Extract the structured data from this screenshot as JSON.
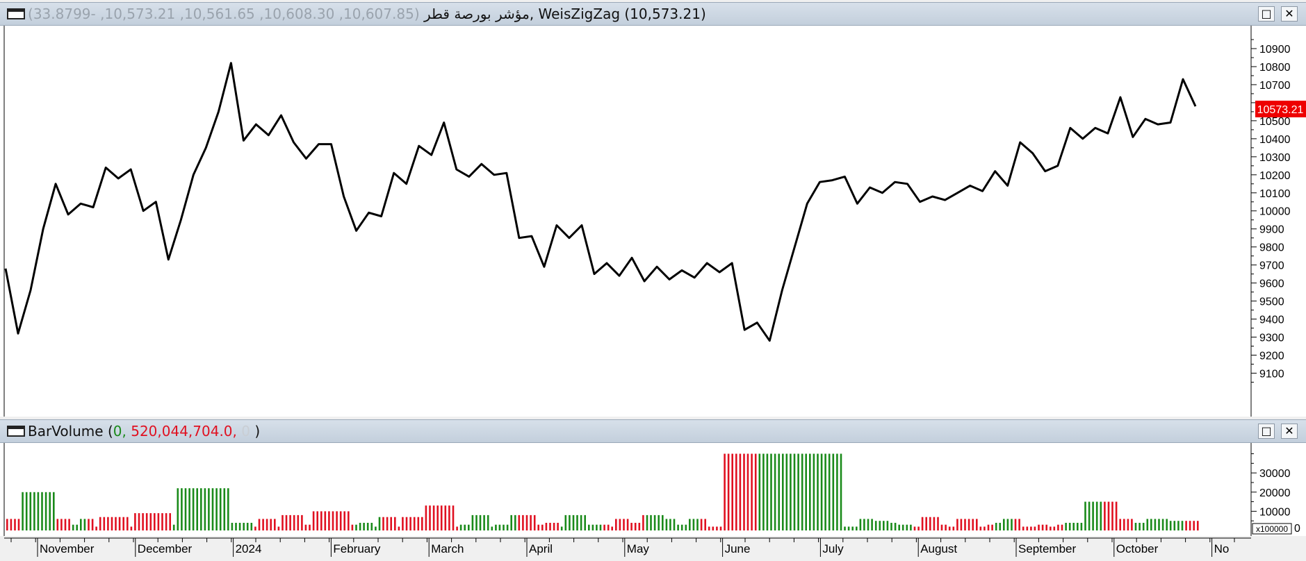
{
  "price_pane": {
    "title_name": "مؤشر بورصة قطر",
    "title_ohlc": "(10,607.85, 10,608.30, 10,561.65, 10,573.21, -33.8799)",
    "title_indicator": ", WeisZigZag (10,573.21)",
    "last_value_label": "10573.21",
    "maximize_icon": "maximize-icon",
    "close_icon": "close-icon"
  },
  "volume_pane": {
    "title_name": "BarVolume",
    "title_open": " (",
    "title_v1": "0,",
    "title_v2": " 520,044,704.0,",
    "title_v3": " 0",
    "title_close": " )",
    "multiplier_label": "x100000",
    "maximize_icon": "maximize-icon",
    "close_icon": "close-icon"
  },
  "chart_data": [
    {
      "type": "line",
      "series": [
        {
          "values": [
            9680,
            9320,
            9560,
            9900,
            10150,
            9980,
            10040,
            10020,
            10240,
            10180,
            10230,
            10000,
            10050,
            9730,
            9950,
            10200,
            10350,
            10550,
            10820,
            10390,
            10480,
            10420,
            10530,
            10380,
            10290,
            10370,
            10370,
            10080,
            9890,
            9990,
            9970,
            10210,
            10150,
            10360,
            10310,
            10490,
            10230,
            10190,
            10260,
            10200,
            10210,
            9850,
            9860,
            9690,
            9920,
            9850,
            9920,
            9650,
            9710,
            9640,
            9740,
            9610,
            9690,
            9620,
            9670,
            9630,
            9710,
            9660,
            9710,
            9340,
            9380,
            9280,
            9560,
            9800,
            10040,
            10160,
            10170,
            10190,
            10040,
            10130,
            10100,
            10160,
            10150,
            10050,
            10080,
            10060,
            10100,
            10140,
            10110,
            10220,
            10140,
            10380,
            10320,
            10220,
            10250,
            10460,
            10400,
            10460,
            10430,
            10630,
            10410,
            10510,
            10480,
            10490,
            10730,
            10580
          ]
        }
      ],
      "ylim": [
        9000,
        11000
      ],
      "yticks": [
        9100,
        9200,
        9300,
        9400,
        9500,
        9600,
        9700,
        9800,
        9900,
        10000,
        10100,
        10200,
        10300,
        10400,
        10500,
        10600,
        10700,
        10800,
        10900
      ],
      "ytick_labels": [
        "9100",
        "9200",
        "9300",
        "9400",
        "9500",
        "9600",
        "9700",
        "9800",
        "9900",
        "10000",
        "10100",
        "10200",
        "10300",
        "10400",
        "10500",
        "",
        "10700",
        "10800",
        "10900"
      ]
    },
    {
      "type": "bar",
      "values": [
        6,
        6,
        6,
        6,
        20,
        20,
        20,
        20,
        20,
        20,
        20,
        20,
        20,
        6,
        6,
        6,
        6,
        3,
        3,
        6,
        6,
        6,
        6,
        2,
        7,
        7,
        7,
        7,
        7,
        7,
        7,
        7,
        2,
        9,
        9,
        9,
        9,
        9,
        9,
        9,
        9,
        9,
        9,
        3,
        22,
        22,
        22,
        22,
        22,
        22,
        22,
        22,
        22,
        22,
        22,
        22,
        22,
        22,
        4,
        4,
        4,
        4,
        4,
        4,
        2,
        6,
        6,
        6,
        6,
        6,
        2,
        8,
        8,
        8,
        8,
        8,
        8,
        3,
        3,
        10,
        10,
        10,
        10,
        10,
        10,
        10,
        10,
        10,
        10,
        3,
        3,
        4,
        4,
        4,
        4,
        2,
        7,
        7,
        7,
        7,
        7,
        2,
        7,
        7,
        7,
        7,
        7,
        7,
        13,
        13,
        13,
        13,
        13,
        13,
        13,
        13,
        2,
        3,
        3,
        3,
        8,
        8,
        8,
        8,
        8,
        2,
        3,
        3,
        3,
        3,
        8,
        8,
        8,
        8,
        8,
        8,
        8,
        3,
        3,
        4,
        4,
        4,
        4,
        2,
        8,
        8,
        8,
        8,
        8,
        8,
        3,
        3,
        3,
        3,
        3,
        3,
        2,
        6,
        6,
        6,
        6,
        4,
        4,
        4,
        8,
        8,
        8,
        8,
        8,
        8,
        6,
        6,
        6,
        3,
        3,
        3,
        6,
        6,
        6,
        6,
        6,
        2,
        2,
        2,
        2,
        40,
        40,
        40,
        40,
        40,
        40,
        40,
        40,
        40,
        40,
        40,
        40,
        40,
        40,
        40,
        40,
        40,
        40,
        40,
        40,
        40,
        40,
        40,
        40,
        40,
        40,
        40,
        40,
        40,
        40,
        40,
        2,
        2,
        2,
        2,
        6,
        6,
        6,
        6,
        5,
        5,
        5,
        5,
        4,
        4,
        3,
        3,
        3,
        3,
        2,
        2,
        7,
        7,
        7,
        7,
        7,
        3,
        3,
        2,
        2,
        6,
        6,
        6,
        6,
        6,
        6,
        2,
        2,
        3,
        3,
        4,
        4,
        6,
        6,
        6,
        6,
        6,
        2,
        2,
        2,
        2,
        3,
        3,
        3,
        2,
        2,
        3,
        3,
        4,
        4,
        4,
        4,
        4,
        15,
        15,
        15,
        15,
        15,
        15,
        15,
        15,
        15,
        6,
        6,
        6,
        6,
        4,
        4,
        4,
        6,
        6,
        6,
        6,
        6,
        6,
        5,
        5,
        5,
        5,
        5,
        5,
        5,
        5
      ],
      "colors": "RRRRGGGGGGGGGRRRRGGGGRRRRRRRRRRRRRRRRRRRRRRGGGGGGGGGGGGGGGGGGGGGRRRRRRRRRRRRRRRRRRRRRRRRRRGGGGGGGRRRRRRRRRRRRRRRRRRRRGGGGGGGGGGGGGGGRRRRRRRRRRRGGGGGGGGGGGRRRRRRRRRRRGGGGGGGGGGGGGGRRRRRRRRRRRRRRRGGGGGGGGGGGGGGGGGGGGGGGGGGGGGGGGGGGGGGGGRRRRRRRRRRRRRRRRRRRRRGGGGGRRRRRRRRRRRRRGGGGGGGGGGRRRRRRRRGGGGGGGGGGGGGRRRRRRRRRRRRRRRRRRRRRR",
      "ylim": [
        0,
        42000
      ],
      "yticks": [
        10000,
        20000,
        30000
      ],
      "ytick_labels": [
        "10000",
        "20000",
        "30000"
      ],
      "zero_label": "0"
    }
  ],
  "x_axis": {
    "labels": [
      "November",
      "December",
      "2024",
      "February",
      "March",
      "April",
      "May",
      "June",
      "July",
      "August",
      "September",
      "October",
      "No"
    ]
  },
  "colors": {
    "price_line": "#000000",
    "volume_up": "#1a8a1a",
    "volume_down": "#e01020",
    "last_value_bg": "#ee0000"
  }
}
